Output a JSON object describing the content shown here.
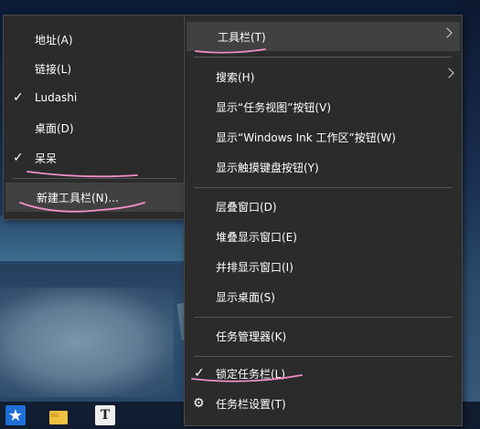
{
  "submenu": {
    "items": [
      {
        "label": "地址(A)",
        "checked": false
      },
      {
        "label": "链接(L)",
        "checked": false
      },
      {
        "label": "Ludashi",
        "checked": true
      },
      {
        "label": "桌面(D)",
        "checked": false
      },
      {
        "label": "呆呆",
        "checked": true
      }
    ],
    "new_toolbar": "新建工具栏(N)..."
  },
  "mainmenu": {
    "toolbar": "工具栏(T)",
    "search": "搜索(H)",
    "show_taskview": "显示“任务视图”按钮(V)",
    "show_ink": "显示“Windows Ink 工作区”按钮(W)",
    "show_touch_keyboard": "显示触摸键盘按钮(Y)",
    "cascade": "层叠窗口(D)",
    "stack": "堆叠显示窗口(E)",
    "side_by_side": "并排显示窗口(I)",
    "show_desktop": "显示桌面(S)",
    "task_manager": "任务管理器(K)",
    "lock_taskbar": "锁定任务栏(L)",
    "taskbar_settings": "任务栏设置(T)"
  },
  "taskbar": {
    "text_app_letter": "T"
  },
  "icons": {
    "check": "check-icon",
    "submenu_arrow": "chevron-right-icon",
    "settings": "gear-icon"
  },
  "colors": {
    "menu_bg": "#2b2b2b",
    "menu_highlight": "#414141",
    "annotation_pen": "#f28fc7"
  }
}
